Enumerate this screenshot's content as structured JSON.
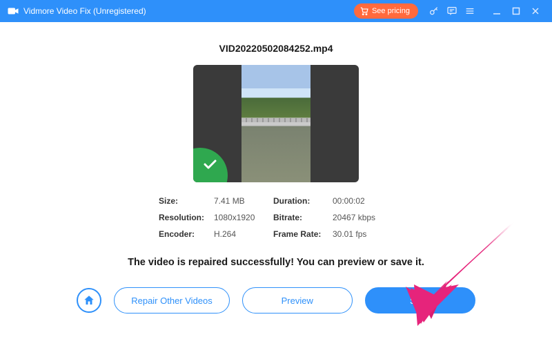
{
  "titlebar": {
    "title": "Vidmore Video Fix (Unregistered)",
    "pricing_label": "See pricing"
  },
  "main": {
    "filename": "VID20220502084252.mp4",
    "success_message": "The video is repaired successfully! You can preview or save it."
  },
  "meta": {
    "size_label": "Size:",
    "size_value": "7.41 MB",
    "duration_label": "Duration:",
    "duration_value": "00:00:02",
    "resolution_label": "Resolution:",
    "resolution_value": "1080x1920",
    "bitrate_label": "Bitrate:",
    "bitrate_value": "20467 kbps",
    "encoder_label": "Encoder:",
    "encoder_value": "H.264",
    "framerate_label": "Frame Rate:",
    "framerate_value": "30.01 fps"
  },
  "actions": {
    "repair_other_label": "Repair Other Videos",
    "preview_label": "Preview",
    "save_label": "Save"
  },
  "colors": {
    "accent": "#2e90fa",
    "pricing": "#ff6a3d",
    "success": "#2fa84f",
    "annotation": "#e6247b"
  }
}
